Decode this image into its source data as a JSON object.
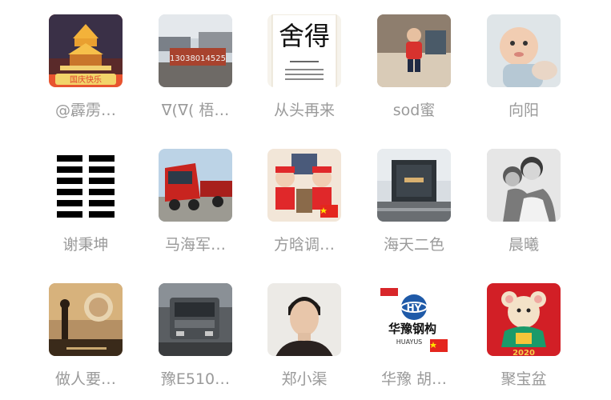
{
  "contacts": [
    {
      "name": "@霹雳…",
      "avatar": "tower-night-avatar-icon",
      "avatar_caption": "国庆快乐"
    },
    {
      "name": "ᐁ(ᐁ(  梧…",
      "avatar": "construction-sign-avatar-icon",
      "avatar_caption": "13038014525"
    },
    {
      "name": "从头再来",
      "avatar": "calligraphy-avatar-icon",
      "avatar_caption": "舍得"
    },
    {
      "name": "sod蜜",
      "avatar": "child-photo-avatar-icon"
    },
    {
      "name": "向阳",
      "avatar": "baby-photo-avatar-icon"
    },
    {
      "name": "谢秉坤",
      "avatar": "hexagram-avatar-icon"
    },
    {
      "name": "马海军…",
      "avatar": "red-truck-avatar-icon"
    },
    {
      "name": "方晗调…",
      "avatar": "kids-flag-avatar-icon"
    },
    {
      "name": "海天二色",
      "avatar": "building-avatar-icon"
    },
    {
      "name": "晨曦",
      "avatar": "mono-portrait-avatar-icon"
    },
    {
      "name": "做人要…",
      "avatar": "sunset-figure-avatar-icon"
    },
    {
      "name": "豫E510…",
      "avatar": "gray-truck-avatar-icon"
    },
    {
      "name": "郑小渠",
      "avatar": "man-portrait-avatar-icon"
    },
    {
      "name": "华豫 胡…",
      "avatar": "huayu-logo-avatar-icon",
      "avatar_caption": "华豫钢构",
      "avatar_caption_sub": "HUAYUS"
    },
    {
      "name": "聚宝盆",
      "avatar": "mouse-newyear-avatar-icon"
    }
  ]
}
